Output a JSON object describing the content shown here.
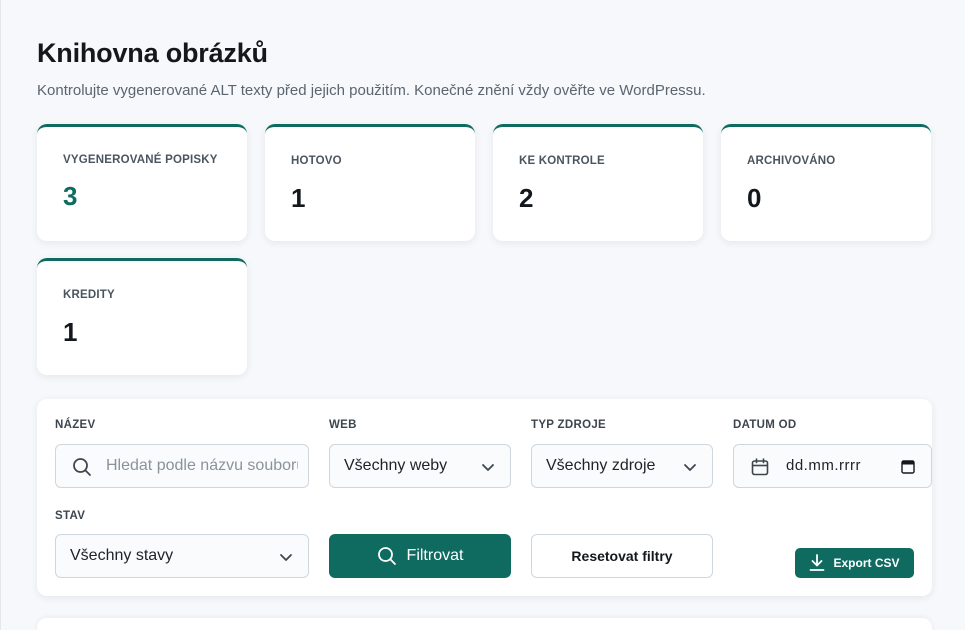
{
  "header": {
    "title": "Knihovna obrázků",
    "subtitle": "Kontrolujte vygenerované ALT texty před jejich použitím. Konečné znění vždy ověřte ve WordPressu."
  },
  "stats": [
    {
      "label": "VYGENEROVANÉ POPISKY",
      "value": "3"
    },
    {
      "label": "HOTOVO",
      "value": "1"
    },
    {
      "label": "KE KONTROLE",
      "value": "2"
    },
    {
      "label": "ARCHIVOVÁNO",
      "value": "0"
    },
    {
      "label": "KREDITY",
      "value": "1"
    }
  ],
  "filters": {
    "name": {
      "label": "NÁZEV",
      "placeholder": "Hledat podle názvu souboru",
      "value": ""
    },
    "web": {
      "label": "WEB",
      "selected": "Všechny weby"
    },
    "source_type": {
      "label": "TYP ZDROJE",
      "selected": "Všechny zdroje"
    },
    "date_from": {
      "label": "DATUM OD",
      "value": "dd.mm.rrrr"
    },
    "status": {
      "label": "STAV",
      "selected": "Všechny stavy"
    },
    "filter_button": "Filtrovat",
    "reset_button": "Resetovat filtry",
    "export_button": "Export CSV"
  },
  "colors": {
    "accent": "#0f6b5f",
    "background": "#f6f8fb",
    "card": "#ffffff"
  }
}
